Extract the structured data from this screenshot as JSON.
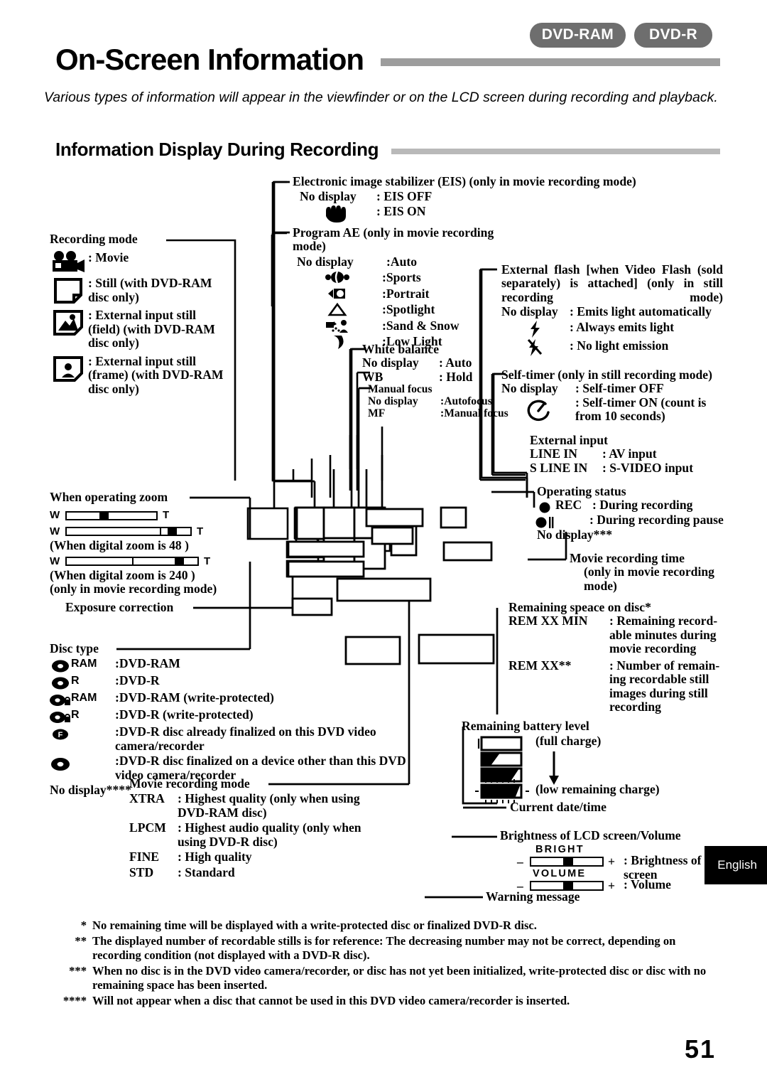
{
  "header": {
    "badges": [
      "DVD-RAM",
      "DVD-R"
    ],
    "title": "On-Screen Information",
    "intro": "Various types of information will appear in the viewfinder or on the LCD screen during recording and playback.",
    "section_title": "Information Display During Recording"
  },
  "recording_mode": {
    "heading": "Recording mode",
    "items": [
      {
        "icon": "movie-camera-icon",
        "text": ": Movie"
      },
      {
        "icon": "still-page-icon",
        "text": ": Still  (with  DVD-RAM disc only)"
      },
      {
        "icon": "external-input-field-icon",
        "text": ": External input still (field) (with DVD-RAM disc only)"
      },
      {
        "icon": "external-input-frame-icon",
        "text": ": External input still (frame) (with DVD-RAM disc only)"
      }
    ]
  },
  "eis": {
    "heading": "Electronic image stabilizer (EIS) (only in movie recording mode)",
    "rows": [
      {
        "sym": "No display",
        "text": ": EIS OFF"
      },
      {
        "sym": "hand-icon",
        "text": ": EIS ON"
      }
    ]
  },
  "program_ae": {
    "heading": "Program AE (only in movie recording mode)",
    "rows": [
      {
        "sym": "No display",
        "text": ":Auto"
      },
      {
        "sym": "sports-icon",
        "text": ":Sports"
      },
      {
        "sym": "portrait-icon",
        "text": ":Portrait"
      },
      {
        "sym": "spotlight-icon",
        "text": ":Spotlight"
      },
      {
        "sym": "sand-snow-icon",
        "text": ":Sand & Snow"
      },
      {
        "sym": "low-light-icon",
        "text": ":Low Light"
      }
    ]
  },
  "white_balance": {
    "heading": "White balance",
    "rows": [
      {
        "sym": "No display",
        "text": ": Auto"
      },
      {
        "sym": "WB",
        "text": ": Hold"
      }
    ]
  },
  "manual_focus": {
    "heading": "Manual focus",
    "rows": [
      {
        "sym": "No display",
        "text": ":Autofocus"
      },
      {
        "sym": "MF",
        "text": ":Manual focus"
      }
    ]
  },
  "external_flash": {
    "heading": "External  flash  [when  Video  Flash (sold separately) is attached] (only in still recording mode)",
    "rows": [
      {
        "sym": "No display",
        "text": ": Emits light automatically"
      },
      {
        "sym": "flash-on-icon",
        "text": ": Always emits light"
      },
      {
        "sym": "flash-off-icon",
        "text": ": No light emission"
      }
    ]
  },
  "self_timer": {
    "heading": "Self-timer (only in still recording mode)",
    "rows": [
      {
        "sym": "No display",
        "text": ": Self-timer OFF"
      },
      {
        "sym": "self-timer-icon",
        "text": ": Self-timer ON (count is from 10 seconds)"
      }
    ]
  },
  "external_input": {
    "heading": "External input",
    "rows": [
      {
        "sym": "LINE IN",
        "text": ": AV input"
      },
      {
        "sym": "S LINE IN",
        "text": ": S-VIDEO input"
      }
    ]
  },
  "operating_status": {
    "heading": "Operating status",
    "rows": [
      {
        "sym": "rec-dot-icon",
        "label": "REC",
        "text": ": During recording"
      },
      {
        "sym": "rec-pause-icon",
        "label": "",
        "text": ": During recording pause"
      },
      {
        "sym": "No display***",
        "label": "",
        "text": ""
      }
    ]
  },
  "movie_recording_time": {
    "heading": "Movie recording time",
    "sub": "(only  in  movie  recording mode)"
  },
  "remaining_space": {
    "heading": "Remaining speace on disc*",
    "rows": [
      {
        "sym": "REM XX MIN",
        "text": ": Remaining  record-able minutes during movie recording"
      },
      {
        "sym": "REM XX**",
        "text": ": Number  of  remain-ing  recordable  still images  during  still recording"
      }
    ]
  },
  "battery": {
    "heading": "Remaining battery level",
    "full_label": "(full charge)",
    "low_label": "(low remaining charge)"
  },
  "datetime": {
    "heading": "Current date/time"
  },
  "brightness_volume": {
    "heading": "Brightness of LCD screen/Volume",
    "rows": [
      {
        "minus": "–",
        "cap": "BRIGHT",
        "plus": "+",
        "text": ": Brightness of LCD screen"
      },
      {
        "minus": "–",
        "cap": "VOLUME",
        "plus": "+",
        "text": ": Volume"
      }
    ]
  },
  "warning": {
    "heading": "Warning message"
  },
  "zoom": {
    "heading": "When operating zoom",
    "bar1": {
      "w": "W",
      "t": "T"
    },
    "bar2": {
      "w": "W",
      "t": "T"
    },
    "note2": "(When digital zoom is 48  )",
    "bar3": {
      "w": "W",
      "t": "T"
    },
    "note3": "(When digital zoom is 240  )",
    "note4": "(only in movie recording mode)"
  },
  "exposure": {
    "heading": "Exposure correction"
  },
  "disc_type": {
    "heading": "Disc type",
    "rows": [
      {
        "icon": "disc-icon",
        "code": "RAM",
        "text": ":DVD-RAM"
      },
      {
        "icon": "disc-icon",
        "code": "R",
        "text": ":DVD-R"
      },
      {
        "icon": "disc-lock-icon",
        "code": "RAM",
        "text": ":DVD-RAM (write-protected)"
      },
      {
        "icon": "disc-lock-icon",
        "code": "R",
        "text": ":DVD-R (write-protected)"
      },
      {
        "icon": "disc-finalized-icon",
        "code": "",
        "text": ":DVD-R disc already finalized on this DVD video camera/recorder"
      },
      {
        "icon": "disc-plain-icon",
        "code": "",
        "text": ":DVD-R disc finalized on a device other than this DVD video camera/recorder"
      }
    ],
    "no_display": "No display****"
  },
  "movie_rec_mode": {
    "heading": "Movie recording mode",
    "rows": [
      {
        "sym": "XTRA",
        "text": ": Highest quality (only when using DVD-RAM disc)"
      },
      {
        "sym": "LPCM",
        "text": ": Highest audio quality (only when using DVD-R disc)"
      },
      {
        "sym": "FINE",
        "text": ": High quality"
      },
      {
        "sym": "STD",
        "text": ": Standard"
      }
    ]
  },
  "footnotes": [
    {
      "mark": "*",
      "text": "No remaining time will be displayed with a write-protected disc or finalized DVD-R disc."
    },
    {
      "mark": "**",
      "text": "The displayed number of recordable stills is for reference: The decreasing number may not be correct, depending on recording condition (not displayed with a DVD-R disc)."
    },
    {
      "mark": "***",
      "text": "When no disc is in the DVD video camera/recorder, or disc has not yet been initialized, write-protected disc or disc with no remaining space has been inserted."
    },
    {
      "mark": "****",
      "text": "Will not appear when a disc that cannot be used in this DVD video camera/recorder is inserted."
    }
  ],
  "page_number": "51",
  "language_tab": "English",
  "colors": {
    "badge": "#6e6e6e",
    "title_rule": "#9d9d9d",
    "section_rule": "#b9b9b9",
    "ink": "#000000"
  }
}
